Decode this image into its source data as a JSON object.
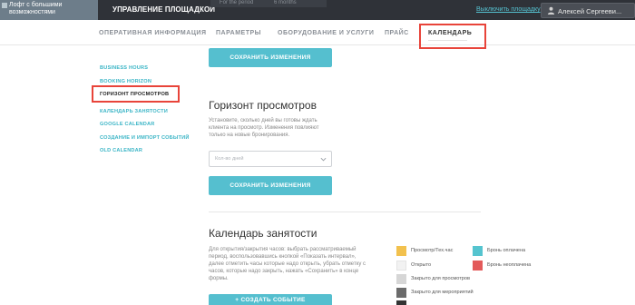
{
  "topbar": {
    "venue_name": "Лофт с большими возможностями",
    "title": "УПРАВЛЕНИЕ ПЛОЩАДКОЙ",
    "period_label": "For the period",
    "period_value": "6 months",
    "disable_link": "Выключить площадку",
    "user_name": "Алексей Сергееви..."
  },
  "tabs": [
    {
      "label": "ОПЕРАТИВНАЯ ИНФОРМАЦИЯ"
    },
    {
      "label": "ПАРАМЕТРЫ"
    },
    {
      "label": "ОБОРУДОВАНИЕ И УСЛУГИ"
    },
    {
      "label": "ПРАЙС"
    },
    {
      "label": "КАЛЕНДАРЬ"
    }
  ],
  "sidebar": {
    "items": [
      {
        "label": "BUSINESS HOURS"
      },
      {
        "label": "BOOKING HORIZON"
      },
      {
        "label": "ГОРИЗОНТ ПРОСМОТРОВ"
      },
      {
        "label": "КАЛЕНДАРЬ ЗАНЯТОСТИ"
      },
      {
        "label": "GOOGLE CALENDAR"
      },
      {
        "label": "СОЗДАНИЕ И ИМПОРТ СОБЫТИЙ"
      },
      {
        "label": "OLD CALENDAR"
      }
    ]
  },
  "main": {
    "save_label": "СОХРАНИТЬ ИЗМЕНЕНИЯ",
    "horizon": {
      "title": "Горизонт просмотров",
      "description": "Установите, сколько дней вы готовы ждать клиента на просмотр. Изменения повлияют только на новые бронирования.",
      "select_placeholder": "Кол-во дней"
    },
    "occupancy": {
      "title": "Календарь занятости",
      "description": "Для открытия/закрытия часов: выбрать рассматриваемый период, воспользовавшись кнопкой «Показать интервал», далее отметить часы которые надо открыть, убрать отметку с часов, которые надо закрыть, нажать «Сохранить» в конце формы.",
      "create_label": "+ СОЗДАТЬ СОБЫТИЕ"
    }
  },
  "legend": [
    {
      "label": "Просмотр/Тех.час",
      "color": "#f2c14e"
    },
    {
      "label": "Открыто",
      "color": "#f2f2f2"
    },
    {
      "label": "Закрыто для просмотров",
      "color": "#d6d6d6"
    },
    {
      "label": "Закрыто для мероприятий",
      "color": "#6b6b6b"
    },
    {
      "label": "Бронь оплачена",
      "color": "#55c4cf"
    },
    {
      "label": "Бронь неоплачена",
      "color": "#e35a5a"
    }
  ],
  "colors": {
    "accent": "#55bfcf",
    "highlight": "#e8443a",
    "topbar": "#2f3238"
  }
}
